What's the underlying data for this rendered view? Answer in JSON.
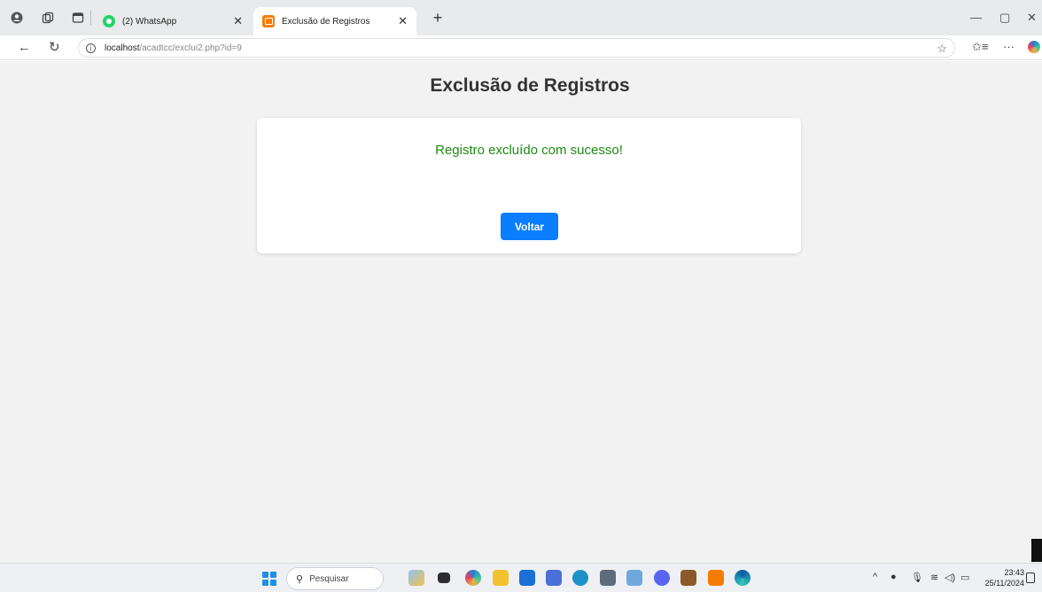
{
  "browser": {
    "tabs": [
      {
        "label": "(2) WhatsApp",
        "favicon": "whatsapp-icon",
        "active": false
      },
      {
        "label": "Exclusão de Registros",
        "favicon": "xampp-icon",
        "active": true
      }
    ],
    "url": {
      "host": "localhost",
      "path": "/acadtcc/exclui2.php?id=9"
    }
  },
  "page": {
    "title": "Exclusão de Registros",
    "message": "Registro excluído com sucesso!",
    "back_button": "Voltar",
    "colors": {
      "background": "#f2f2f2",
      "success": "#1e8a12",
      "button": "#0b7dff"
    }
  },
  "taskbar": {
    "search_placeholder": "Pesquisar",
    "time": "23:43",
    "date": "25/11/2024"
  }
}
